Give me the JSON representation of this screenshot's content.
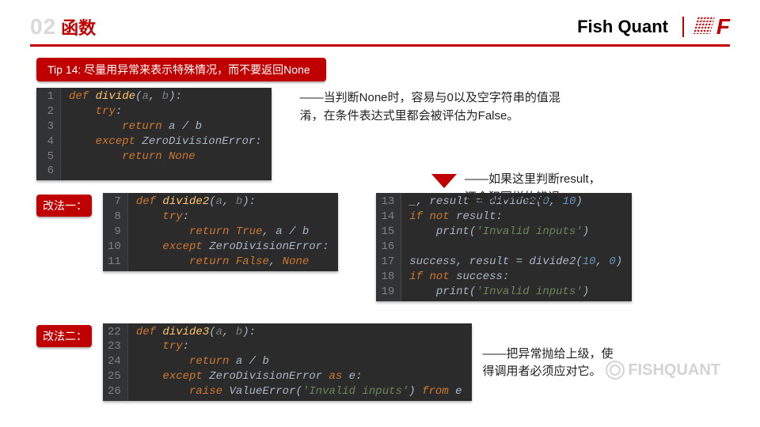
{
  "header": {
    "chapter_num": "02",
    "chapter_title": "函数",
    "brand": "Fish Quant",
    "logo_letter": "F"
  },
  "tip": {
    "label": "Tip 14: 尽量用异常来表示特殊情况，而不要返回None"
  },
  "notes": {
    "note1_line1": "——当判断None时，容易与0以及空字符串的值混",
    "note1_line2": "淆，在条件表达式里都会被评估为False。",
    "note2_line1": "——如果这里判断result，",
    "note2_line2": "还会犯同样的错误。",
    "note3_line1": "——把异常抛给上级，使",
    "note3_line2": "得调用者必须应对它。"
  },
  "labels": {
    "method1": "改法一：",
    "method2": "改法二："
  },
  "code1": {
    "lines": [
      "1",
      "2",
      "3",
      "4",
      "5",
      "6"
    ],
    "t": {
      "def": "def ",
      "name": "divide",
      "lp": "(",
      "a": "a",
      "comma": ", ",
      "b": "b",
      "rpc": "):",
      "try": "try",
      "colon": ":",
      "return": "return ",
      "aref": "a",
      "slash": " / ",
      "bref": "b",
      "except": "except ",
      "err": "ZeroDivisionError",
      "none": "None"
    }
  },
  "code2": {
    "lines": [
      "7",
      "8",
      "9",
      "10",
      "11"
    ],
    "t": {
      "def": "def ",
      "name": "divide2",
      "lp": "(",
      "a": "a",
      "comma": ", ",
      "b": "b",
      "rpc": "):",
      "try": "try",
      "colon": ":",
      "return": "return ",
      "true": "True",
      "sep": ", ",
      "aref": "a",
      "slash": " / ",
      "bref": "b",
      "except": "except ",
      "err": "ZeroDivisionError",
      "false": "False",
      "none": "None"
    }
  },
  "code3": {
    "lines": [
      "13",
      "14",
      "15",
      "16",
      "17",
      "18",
      "19"
    ],
    "t": {
      "und": "_",
      "sep1": ", result ",
      "eq": "= ",
      "call": "divide2",
      "lp": "(",
      "z": "0",
      "c": ", ",
      "ten": "10",
      "rp": ")",
      "if": "if ",
      "not": "not ",
      "res": "result",
      "colon": ":",
      "print": "print",
      "lp2": "(",
      "msg": "'Invalid inputs'",
      "rp2": ")",
      "succ": "success",
      "sep2": ", result ",
      "eq2": "= ",
      "call2": "divide2",
      "lp3": "(",
      "ten2": "10",
      "c2": ", ",
      "z2": "0",
      "rp3": ")",
      "if2": "if ",
      "not2": "not ",
      "succv": "success"
    }
  },
  "code4": {
    "lines": [
      "22",
      "23",
      "24",
      "25",
      "26"
    ],
    "t": {
      "def": "def ",
      "name": "divide3",
      "lp": "(",
      "a": "a",
      "comma": ", ",
      "b": "b",
      "rpc": "):",
      "try": "try",
      "colon": ":",
      "return": "return ",
      "aref": "a",
      "slash": " / ",
      "bref": "b",
      "except": "except ",
      "err": "ZeroDivisionError",
      "as": " as ",
      "e": "e",
      "raise": "raise ",
      "verr": "ValueError",
      "lp2": "(",
      "msg": "'Invalid inputs'",
      "rp2": ")",
      "from": " from ",
      "e2": "e"
    }
  },
  "watermark": {
    "text": "FISHQUANT"
  }
}
